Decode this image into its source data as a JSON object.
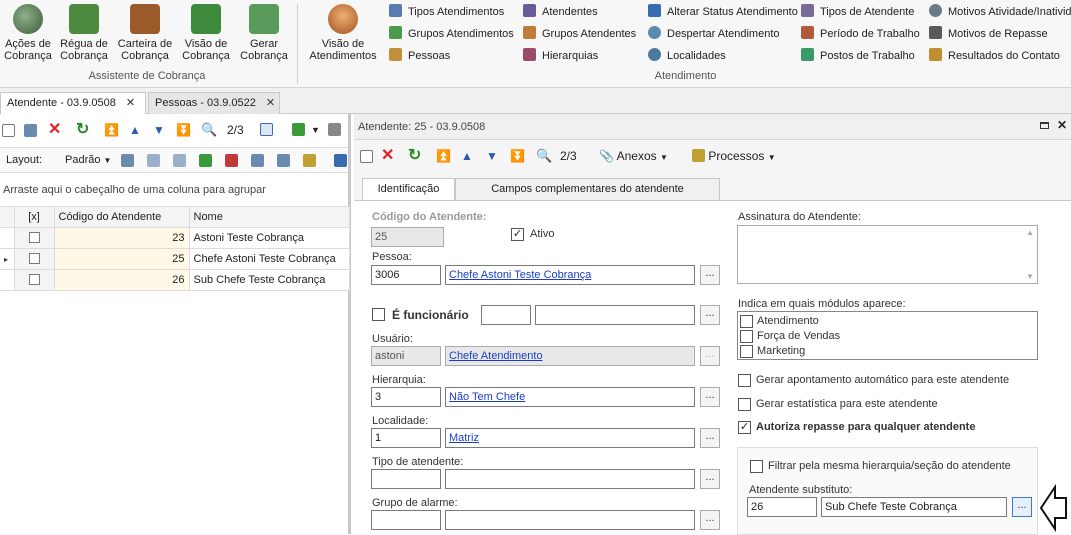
{
  "ribbon": {
    "group1": {
      "label": "Assistente de Cobrança",
      "buttons": [
        {
          "line1": "Ações de",
          "line2": "Cobrança",
          "icon": "balls-icon",
          "color": "#6a8a5a"
        },
        {
          "line1": "Régua de",
          "line2": "Cobrança",
          "icon": "calculator-icon",
          "color": "#4d8a3f"
        },
        {
          "line1": "Carteira de",
          "line2": "Cobrança",
          "icon": "wallet-icon",
          "color": "#9a5a2a"
        },
        {
          "line1": "Visão de",
          "line2": "Cobrança",
          "icon": "money-stack-icon",
          "color": "#3d8a3d"
        },
        {
          "line1": "Gerar",
          "line2": "Cobrança",
          "icon": "money-note-icon",
          "color": "#5a9a5a"
        }
      ]
    },
    "group2": {
      "label": "Atendimento",
      "big": {
        "line1": "Visão de",
        "line2": "Atendimentos",
        "icon": "headset-icon"
      },
      "items": [
        {
          "label": "Tipos Atendimentos",
          "icon": "list-icon",
          "color": "#5a7ab0"
        },
        {
          "label": "Grupos Atendimentos",
          "icon": "group-icon",
          "color": "#4a9a4a"
        },
        {
          "label": "Pessoas",
          "icon": "person-icon",
          "color": "#c0903a"
        },
        {
          "label": "Atendentes",
          "icon": "people-icon",
          "color": "#6a5a9a"
        },
        {
          "label": "Grupos Atendentes",
          "icon": "people-group-icon",
          "color": "#c07a3a"
        },
        {
          "label": "Hierarquias",
          "icon": "hierarchy-icon",
          "color": "#9a4a6a"
        },
        {
          "label": "Alterar Status Atendimento",
          "icon": "status-icon",
          "color": "#3a6ab0"
        },
        {
          "label": "Despertar Atendimento",
          "icon": "alarm-icon",
          "color": "#5a8ab0"
        },
        {
          "label": "Localidades",
          "icon": "globe-icon",
          "color": "#4a7aa0"
        },
        {
          "label": "Tipos de Atendente",
          "icon": "attendant-type-icon",
          "color": "#7a6a9a"
        },
        {
          "label": "Período de Trabalho",
          "icon": "calendar-icon",
          "color": "#b05a3a"
        },
        {
          "label": "Postos de Trabalho",
          "icon": "workstation-icon",
          "color": "#3a9a6a"
        },
        {
          "label": "Motivos Atividade/Inativid",
          "icon": "reason-icon",
          "color": "#6a7a8a"
        },
        {
          "label": "Motivos de Repasse",
          "icon": "transfer-icon",
          "color": "#5a5a5a"
        },
        {
          "label": "Resultados do Contato",
          "icon": "result-icon",
          "color": "#c09030"
        }
      ]
    }
  },
  "doc_tabs": [
    {
      "label": "Atendente - 03.9.0508",
      "close": "✕"
    },
    {
      "label": "Pessoas - 03.9.0522",
      "close": "✕"
    }
  ],
  "left": {
    "nav_count": "2/3",
    "layout_label": "Layout:",
    "layout_value": "Padrão",
    "group_hint": "Arraste aqui o cabeçalho de uma coluna para agrupar",
    "columns": [
      "[x]",
      "Código do Atendente",
      "Nome"
    ],
    "rows": [
      {
        "code": "23",
        "name": "Astoni Teste Cobrança"
      },
      {
        "code": "25",
        "name": "Chefe Astoni Teste Cobrança"
      },
      {
        "code": "26",
        "name": "Sub Chefe Teste Cobrança"
      }
    ]
  },
  "right": {
    "title": "Atendente: 25 - 03.9.0508",
    "nav_count": "2/3",
    "anexos": "Anexos",
    "processos": "Processos",
    "tabs": [
      "Identificação",
      "Campos complementares do atendente"
    ],
    "form": {
      "codigo_label": "Código do Atendente:",
      "codigo_value": "25",
      "ativo_label": "Ativo",
      "pessoa_label": "Pessoa:",
      "pessoa_code": "3006",
      "pessoa_name": "Chefe Astoni Teste Cobrança",
      "funcionario_label": "É funcionário",
      "usuario_label": "Usuário:",
      "usuario_code": "astoni",
      "usuario_name": "Chefe Atendimento",
      "hierarquia_label": "Hierarquia:",
      "hierarquia_code": "3",
      "hierarquia_name": "Não Tem Chefe",
      "localidade_label": "Localidade:",
      "localidade_code": "1",
      "localidade_name": "Matriz",
      "tipo_label": "Tipo de atendente:",
      "grupo_alarme_label": "Grupo de alarme:",
      "assinatura_label": "Assinatura do Atendente:",
      "modulos_label": "Indica em quais módulos aparece:",
      "modulos": [
        "Atendimento",
        "Força de Vendas",
        "Marketing"
      ],
      "gerar_apontamento": "Gerar apontamento automático para este atendente",
      "gerar_estatistica": "Gerar estatística para este atendente",
      "autoriza_repasse": "Autoriza repasse para qualquer atendente",
      "filtrar": "Filtrar pela mesma hierarquia/seção do atendente",
      "substituto_label": "Atendente substituto:",
      "substituto_code": "26",
      "substituto_name": "Sub Chefe Teste Cobrança",
      "ellipsis": "..."
    }
  }
}
